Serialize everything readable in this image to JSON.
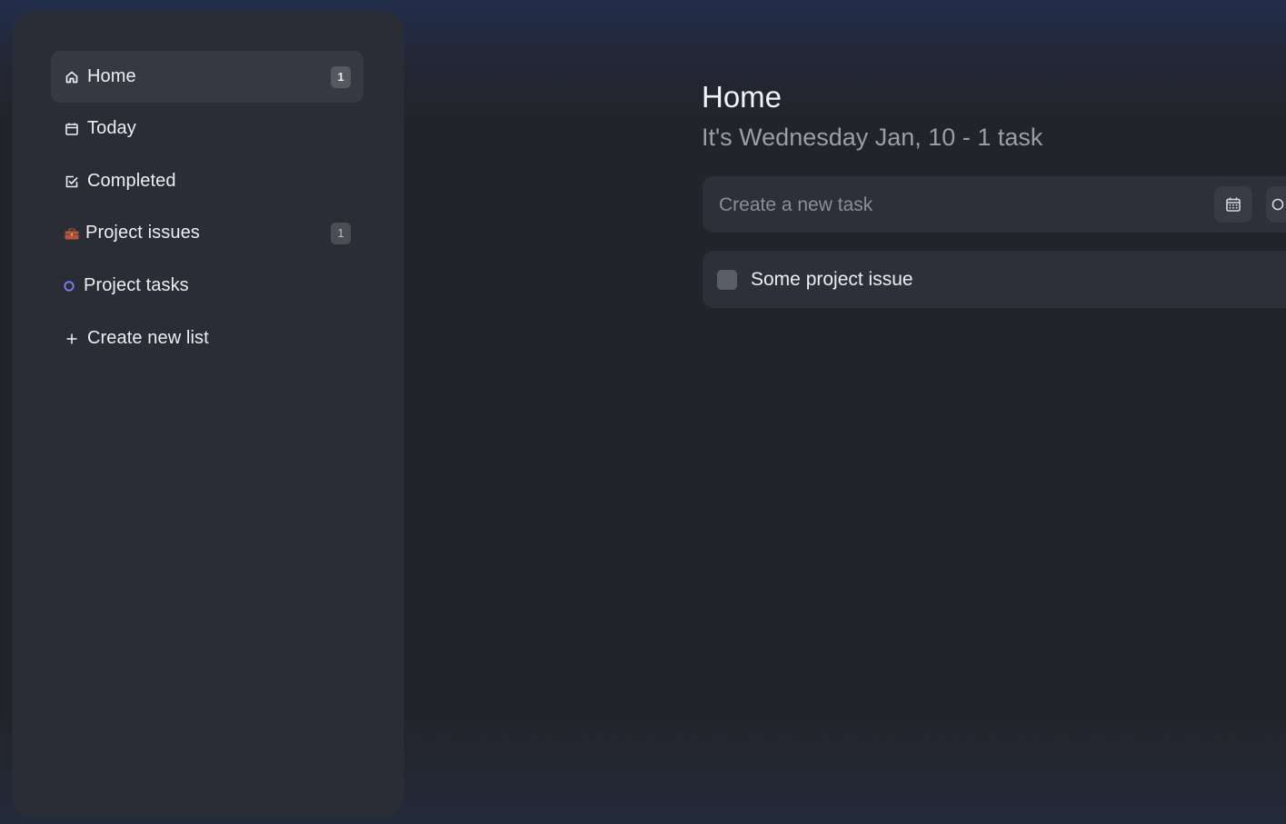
{
  "sidebar": {
    "items": [
      {
        "label": "Home",
        "icon": "home-icon",
        "badge": "1"
      },
      {
        "label": "Today",
        "icon": "calendar-icon"
      },
      {
        "label": "Completed",
        "icon": "check-square-icon"
      },
      {
        "label": "Project issues",
        "icon": "briefcase-icon",
        "badge": "1"
      },
      {
        "label": "Project tasks",
        "icon": "circle-icon"
      },
      {
        "label": "Create new list",
        "icon": "plus-icon"
      }
    ]
  },
  "main": {
    "title": "Home",
    "subtitle": "It's Wednesday Jan, 10 - 1 task",
    "new_task": {
      "placeholder": "Create a new task",
      "date_button_icon": "calendar-icon",
      "list_button_icon": "circle-icon"
    },
    "tasks": [
      {
        "label": "Some project issue",
        "checked": false
      }
    ]
  },
  "colors": {
    "list_circle": "#7b7ff0",
    "briefcase": "#c0563f"
  }
}
